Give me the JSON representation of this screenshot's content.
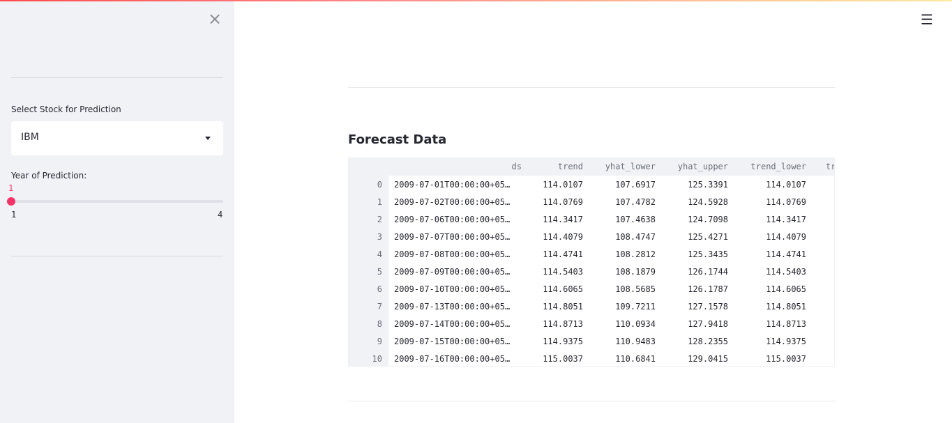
{
  "header": {
    "close_symbol": "×",
    "menu_symbol": "☰",
    "accent": "#f63366"
  },
  "sidebar": {
    "stock_label": "Select Stock for Prediction",
    "stock_value": "IBM",
    "year_label": "Year of Prediction:",
    "slider": {
      "value": "1",
      "min": "1",
      "max": "4",
      "level": 0
    }
  },
  "main": {
    "section_title": "Forecast Data",
    "table": {
      "columns": [
        "ds",
        "trend",
        "yhat_lower",
        "yhat_upper",
        "trend_lower",
        "tr"
      ],
      "rows": [
        {
          "index": "0",
          "ds": "2009-07-01T00:00:00+05…",
          "trend": "114.0107",
          "yhat_lower": "107.6917",
          "yhat_upper": "125.3391",
          "trend_lower": "114.0107"
        },
        {
          "index": "1",
          "ds": "2009-07-02T00:00:00+05…",
          "trend": "114.0769",
          "yhat_lower": "107.4782",
          "yhat_upper": "124.5928",
          "trend_lower": "114.0769"
        },
        {
          "index": "2",
          "ds": "2009-07-06T00:00:00+05…",
          "trend": "114.3417",
          "yhat_lower": "107.4638",
          "yhat_upper": "124.7098",
          "trend_lower": "114.3417"
        },
        {
          "index": "3",
          "ds": "2009-07-07T00:00:00+05…",
          "trend": "114.4079",
          "yhat_lower": "108.4747",
          "yhat_upper": "125.4271",
          "trend_lower": "114.4079"
        },
        {
          "index": "4",
          "ds": "2009-07-08T00:00:00+05…",
          "trend": "114.4741",
          "yhat_lower": "108.2812",
          "yhat_upper": "125.3435",
          "trend_lower": "114.4741"
        },
        {
          "index": "5",
          "ds": "2009-07-09T00:00:00+05…",
          "trend": "114.5403",
          "yhat_lower": "108.1879",
          "yhat_upper": "126.1744",
          "trend_lower": "114.5403"
        },
        {
          "index": "6",
          "ds": "2009-07-10T00:00:00+05…",
          "trend": "114.6065",
          "yhat_lower": "108.5685",
          "yhat_upper": "126.1787",
          "trend_lower": "114.6065"
        },
        {
          "index": "7",
          "ds": "2009-07-13T00:00:00+05…",
          "trend": "114.8051",
          "yhat_lower": "109.7211",
          "yhat_upper": "127.1578",
          "trend_lower": "114.8051"
        },
        {
          "index": "8",
          "ds": "2009-07-14T00:00:00+05…",
          "trend": "114.8713",
          "yhat_lower": "110.0934",
          "yhat_upper": "127.9418",
          "trend_lower": "114.8713"
        },
        {
          "index": "9",
          "ds": "2009-07-15T00:00:00+05…",
          "trend": "114.9375",
          "yhat_lower": "110.9483",
          "yhat_upper": "128.2355",
          "trend_lower": "114.9375"
        },
        {
          "index": "10",
          "ds": "2009-07-16T00:00:00+05…",
          "trend": "115.0037",
          "yhat_lower": "110.6841",
          "yhat_upper": "129.0415",
          "trend_lower": "115.0037"
        }
      ]
    }
  }
}
